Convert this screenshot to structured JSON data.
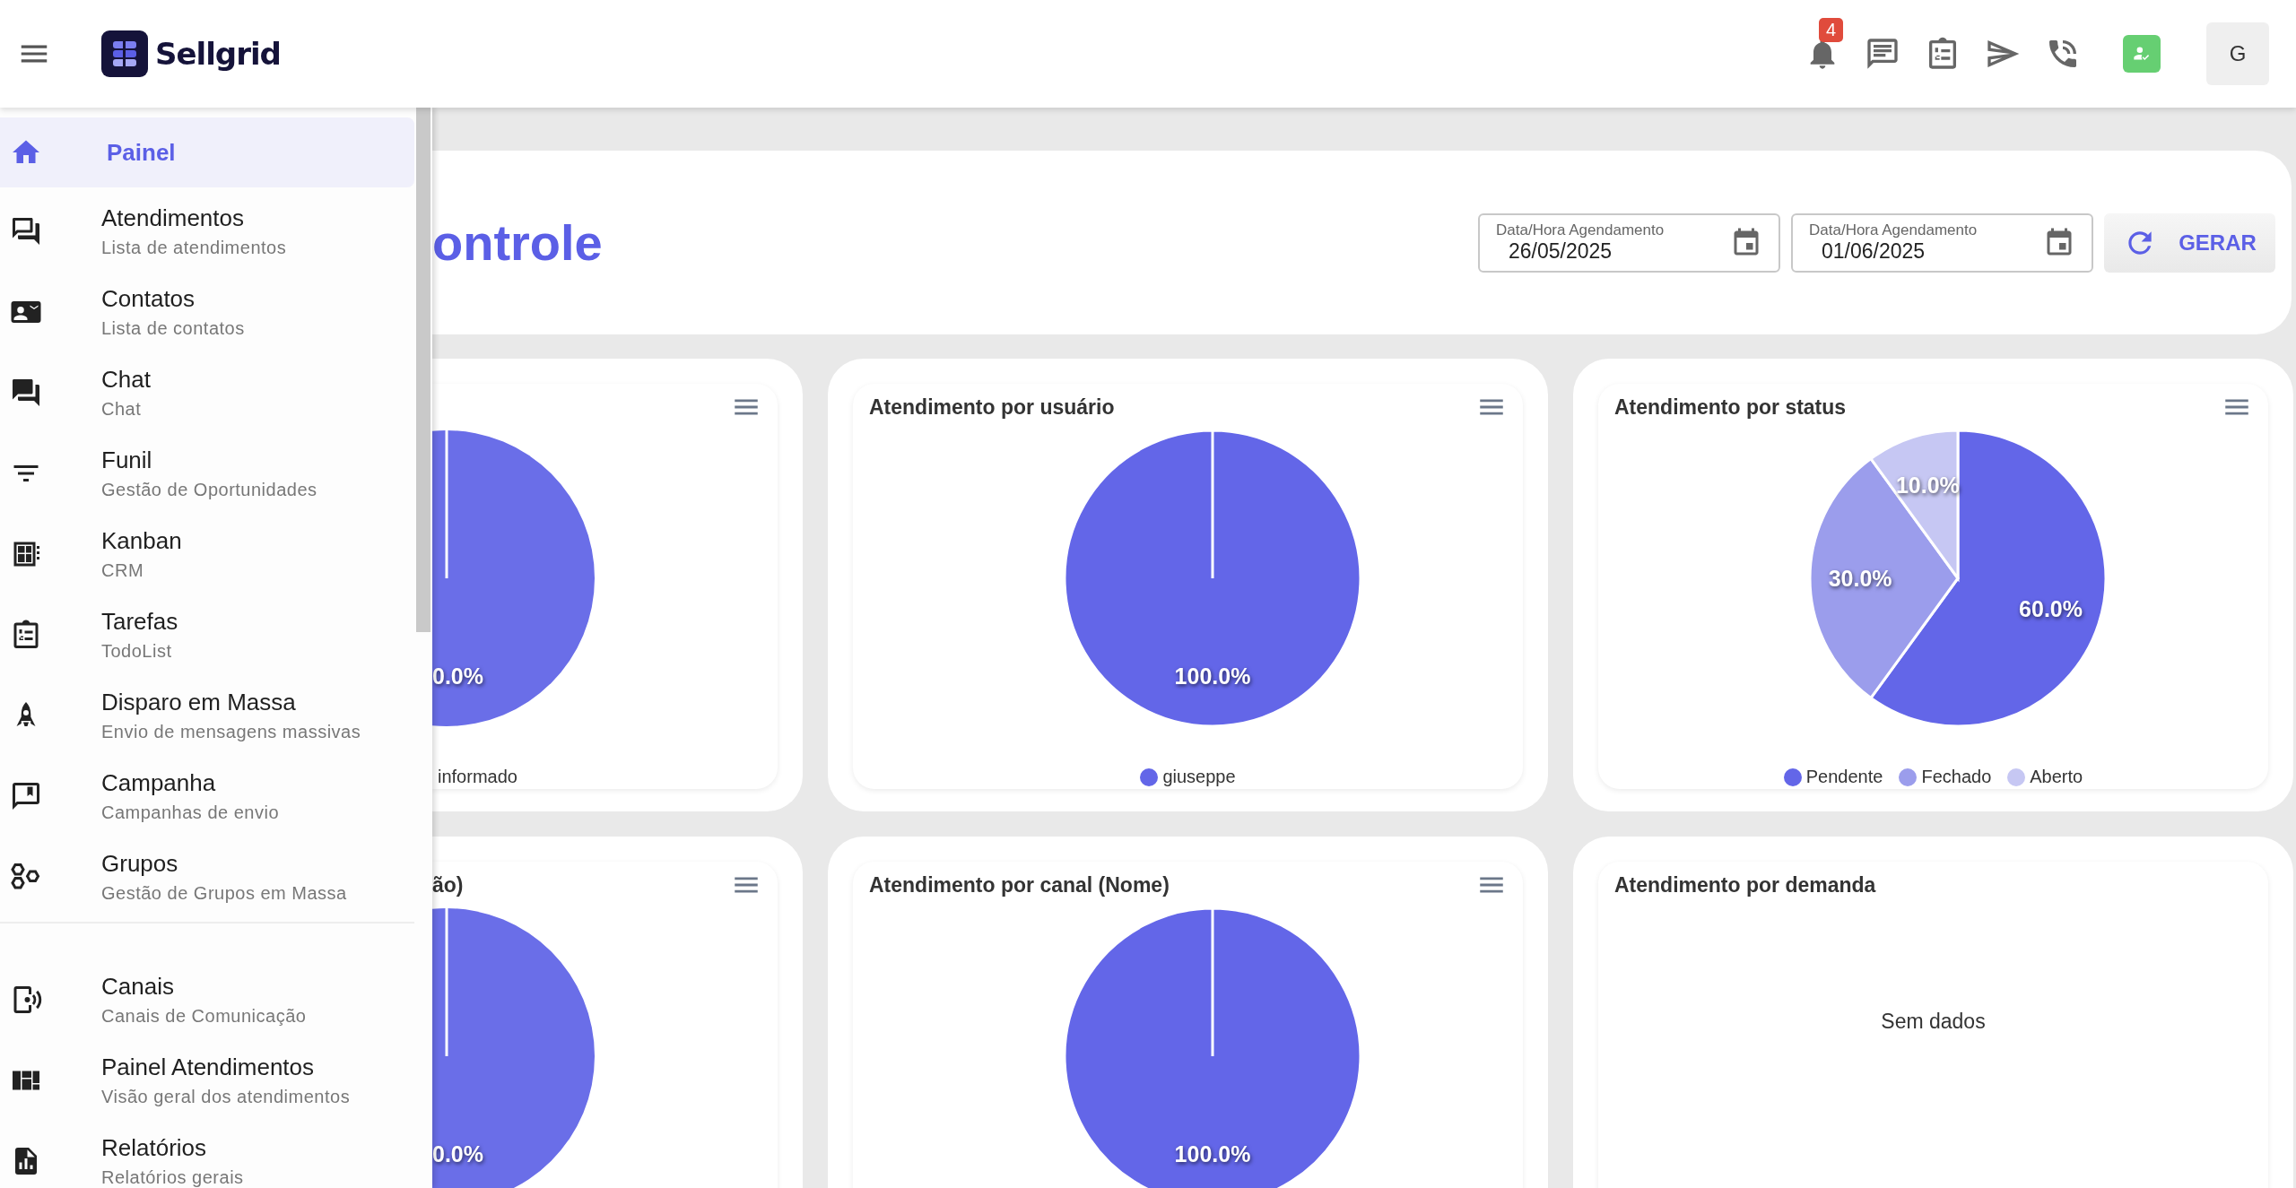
{
  "topbar": {
    "brand": "Sellgrid",
    "notification_count": "4",
    "avatar_initial": "G"
  },
  "sidebar": {
    "sections": [
      {
        "items": [
          {
            "title": "Painel",
            "selected": true
          },
          {
            "title": "Atendimentos",
            "subtitle": "Lista de atendimentos",
            "selected": false
          },
          {
            "title": "Contatos",
            "subtitle": "Lista de contatos",
            "selected": false
          },
          {
            "title": "Chat",
            "subtitle": "Chat",
            "selected": false
          },
          {
            "title": "Funil",
            "subtitle": "Gestão de Oportunidades",
            "selected": false
          },
          {
            "title": "Kanban",
            "subtitle": "CRM",
            "selected": false
          },
          {
            "title": "Tarefas",
            "subtitle": "TodoList",
            "selected": false
          },
          {
            "title": "Disparo em Massa",
            "subtitle": "Envio de mensagens massivas",
            "selected": false
          },
          {
            "title": "Campanha",
            "subtitle": "Campanhas de envio",
            "selected": false
          },
          {
            "title": "Grupos",
            "subtitle": "Gestão de Grupos em Massa",
            "selected": false
          }
        ]
      },
      {
        "items": [
          {
            "title": "Canais",
            "subtitle": "Canais de Comunicação",
            "selected": false
          },
          {
            "title": "Painel Atendimentos",
            "subtitle": "Visão geral dos atendimentos",
            "selected": false
          },
          {
            "title": "Relatórios",
            "subtitle": "Relatórios gerais",
            "selected": false
          }
        ]
      }
    ]
  },
  "header": {
    "title": "ontrole",
    "date_fields": [
      {
        "label": "Data/Hora Agendamento",
        "value": "26/05/2025"
      },
      {
        "label": "Data/Hora Agendamento",
        "value": "01/06/2025"
      }
    ],
    "generate_button": "GERAR"
  },
  "cards": [
    {
      "kind": "clipped",
      "data_label": "0.0%",
      "legend_text": "informado"
    },
    {
      "kind": "pie",
      "chart_data": {
        "type": "pie",
        "title": "Atendimento por usuário",
        "categories": [
          "giuseppe"
        ],
        "values": [
          100
        ],
        "value_labels": [
          "100.0%"
        ],
        "colors": [
          "#6366e8"
        ]
      }
    },
    {
      "kind": "pie",
      "chart_data": {
        "type": "pie",
        "title": "Atendimento por status",
        "categories": [
          "Pendente",
          "Fechado",
          "Aberto"
        ],
        "values": [
          60,
          30,
          10
        ],
        "value_labels": [
          "60.0%",
          "30.0%",
          "10.0%"
        ],
        "colors": [
          "#6366e8",
          "#9b9dec",
          "#c6c7f3"
        ]
      }
    },
    {
      "kind": "clipped",
      "title": "ão)",
      "data_label": "0.0%"
    },
    {
      "kind": "pie",
      "chart_data": {
        "type": "pie",
        "title": "Atendimento por canal (Nome)",
        "values": [
          100
        ],
        "value_labels": [
          "100.0%"
        ],
        "colors": [
          "#6366e8"
        ]
      }
    },
    {
      "kind": "empty",
      "title": "Atendimento por demanda",
      "message": "Sem dados"
    }
  ]
}
